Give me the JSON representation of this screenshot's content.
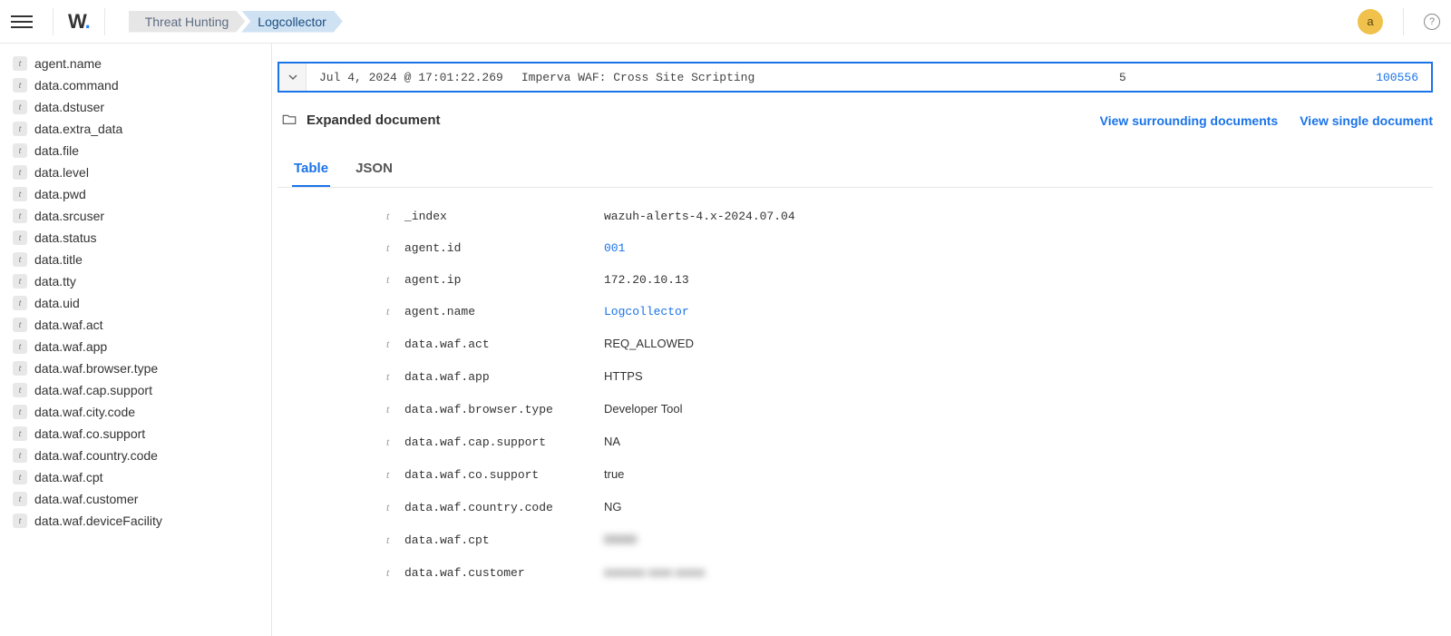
{
  "header": {
    "crumbs": [
      "Threat Hunting",
      "Logcollector"
    ],
    "avatar": "a"
  },
  "sidebar": {
    "fields": [
      "agent.name",
      "data.command",
      "data.dstuser",
      "data.extra_data",
      "data.file",
      "data.level",
      "data.pwd",
      "data.srcuser",
      "data.status",
      "data.title",
      "data.tty",
      "data.uid",
      "data.waf.act",
      "data.waf.app",
      "data.waf.browser.type",
      "data.waf.cap.support",
      "data.waf.city.code",
      "data.waf.co.support",
      "data.waf.country.code",
      "data.waf.cpt",
      "data.waf.customer",
      "data.waf.deviceFacility"
    ]
  },
  "event": {
    "timestamp": "Jul 4, 2024 @ 17:01:22.269",
    "message": "Imperva WAF: Cross Site Scripting",
    "level": "5",
    "ruleId": "100556"
  },
  "expanded": {
    "title": "Expanded document",
    "link_surrounding": "View surrounding documents",
    "link_single": "View single document",
    "tabs": {
      "table": "Table",
      "json": "JSON"
    },
    "rows": [
      {
        "k": "_index",
        "v": "wazuh-alerts-4.x-2024.07.04",
        "mono": true
      },
      {
        "k": "agent.id",
        "v": "001",
        "mono": true,
        "link": true
      },
      {
        "k": "agent.ip",
        "v": "172.20.10.13",
        "mono": true
      },
      {
        "k": "agent.name",
        "v": "Logcollector",
        "mono": true,
        "link": true
      },
      {
        "k": "data.waf.act",
        "v": "REQ_ALLOWED"
      },
      {
        "k": "data.waf.app",
        "v": "HTTPS"
      },
      {
        "k": "data.waf.browser.type",
        "v": "Developer Tool"
      },
      {
        "k": "data.waf.cap.support",
        "v": "NA"
      },
      {
        "k": "data.waf.co.support",
        "v": "true"
      },
      {
        "k": "data.waf.country.code",
        "v": "NG"
      },
      {
        "k": "data.waf.cpt",
        "v": "00000",
        "blur": true
      },
      {
        "k": "data.waf.customer",
        "v": "xxxxxxx xxxx xxxxx",
        "blur": true
      }
    ]
  }
}
